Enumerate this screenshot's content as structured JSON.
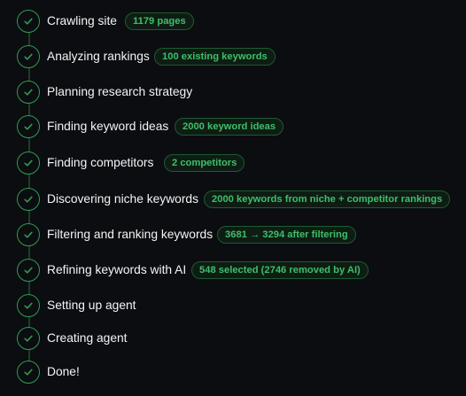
{
  "colors": {
    "background": "#0b0d10",
    "accent": "#2f9b52",
    "badge_text": "#3fbe6a",
    "text": "#f2f4f5"
  },
  "steps": [
    {
      "label": "Crawling site",
      "badge": "1179 pages",
      "status": "done",
      "icon": "check-icon"
    },
    {
      "label": "Analyzing rankings",
      "badge": "100 existing keywords",
      "status": "done",
      "icon": "check-icon"
    },
    {
      "label": "Planning research strategy",
      "badge": null,
      "status": "done",
      "icon": "check-icon"
    },
    {
      "label": "Finding keyword ideas",
      "badge": "2000 keyword ideas",
      "status": "done",
      "icon": "check-icon"
    },
    {
      "label": "Finding competitors",
      "badge": "2 competitors",
      "status": "done",
      "icon": "check-icon"
    },
    {
      "label": "Discovering niche keywords",
      "badge": "2000 keywords from niche + competitor rankings",
      "status": "done",
      "icon": "check-icon"
    },
    {
      "label": "Filtering and ranking keywords",
      "badge": "3681 → 3294 after filtering",
      "status": "done",
      "icon": "check-icon"
    },
    {
      "label": "Refining keywords with AI",
      "badge": "548 selected (2746 removed by AI)",
      "status": "done",
      "icon": "check-icon"
    },
    {
      "label": "Setting up agent",
      "badge": null,
      "status": "done",
      "icon": "check-icon"
    },
    {
      "label": "Creating agent",
      "badge": null,
      "status": "done",
      "icon": "check-icon"
    },
    {
      "label": "Done!",
      "badge": null,
      "status": "done",
      "icon": "check-icon"
    }
  ]
}
